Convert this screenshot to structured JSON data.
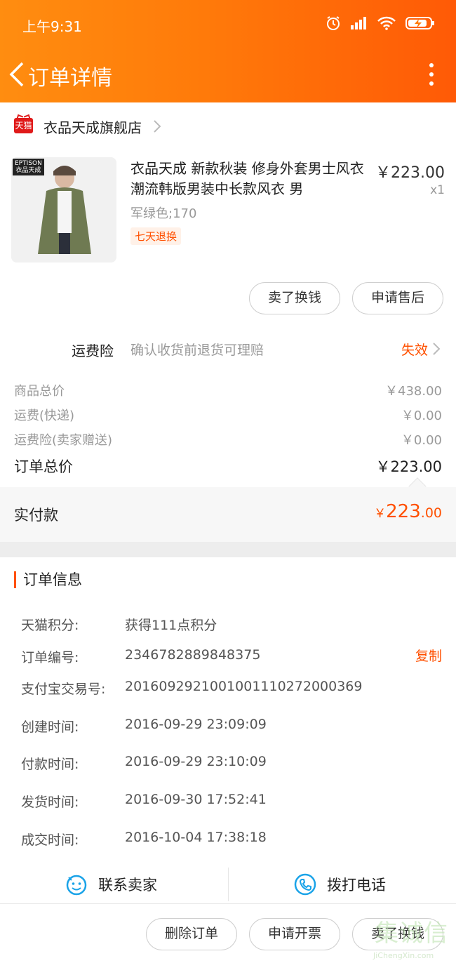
{
  "status_bar": {
    "time": "上午9:31"
  },
  "header": {
    "title": "订单详情"
  },
  "shop": {
    "badge": "天猫",
    "name": "衣品天成旗舰店"
  },
  "product": {
    "brand_tag_line1": "EPTISON",
    "brand_tag_line2": "衣品天成",
    "title": "衣品天成 新款秋装 修身外套男士风衣 潮流韩版男装中长款风衣 男",
    "sku": "军绿色;170",
    "return_tag": "七天退换",
    "price": "￥223.00",
    "quantity": "x1"
  },
  "item_actions": {
    "sell": "卖了换钱",
    "after_sale": "申请售后"
  },
  "insurance": {
    "label": "运费险",
    "desc": "确认收货前退货可理赔",
    "status": "失效"
  },
  "fees": {
    "goods_label": "商品总价",
    "goods_value": "￥438.00",
    "shipping_label": "运费(快递)",
    "shipping_value": "￥0.00",
    "insurance_label": "运费险(卖家赠送)",
    "insurance_value": "￥0.00",
    "total_label": "订单总价",
    "total_value": "￥223.00"
  },
  "paid": {
    "label": "实付款",
    "currency": "￥",
    "integer": "223",
    "decimal": ".00"
  },
  "order_info": {
    "title": "订单信息",
    "copy": "复制",
    "rows": [
      {
        "key": "天猫积分:",
        "value": "获得111点积分"
      },
      {
        "key": "订单编号:",
        "value": "2346782889848375"
      },
      {
        "key": "支付宝交易号:",
        "value": "2016092921001001110272000369"
      },
      {
        "key": "创建时间:",
        "value": "2016-09-29 23:09:09"
      },
      {
        "key": "付款时间:",
        "value": "2016-09-29 23:10:09"
      },
      {
        "key": "发货时间:",
        "value": "2016-09-30 17:52:41"
      },
      {
        "key": "成交时间:",
        "value": "2016-10-04 17:38:18"
      }
    ]
  },
  "contact": {
    "seller": "联系卖家",
    "phone": "拨打电话"
  },
  "bottom_actions": {
    "delete": "删除订单",
    "invoice": "申请开票",
    "sell": "卖了换钱"
  },
  "watermark": {
    "big": "集诚信",
    "small": "JiChengXin.com"
  },
  "colors": {
    "accent": "#ff5000",
    "header_start": "#ff8d10",
    "header_end": "#ff5a06",
    "icon_blue": "#1aa3e8"
  }
}
